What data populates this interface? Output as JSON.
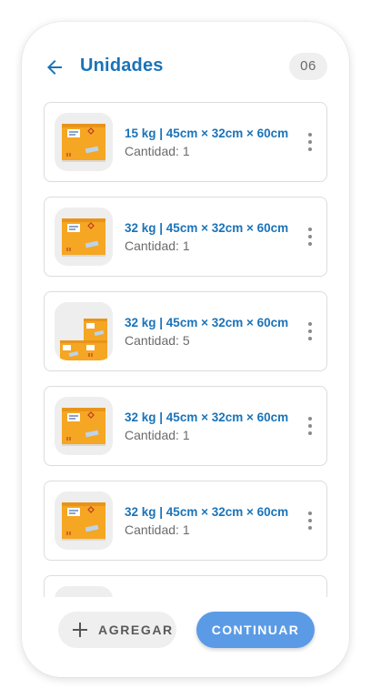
{
  "header": {
    "title": "Unidades",
    "count": "06"
  },
  "units": [
    {
      "dims": "15 kg | 45cm × 32cm × 60cm",
      "qty": "Cantidad: 1",
      "icon": "single-box-icon"
    },
    {
      "dims": "32 kg | 45cm × 32cm × 60cm",
      "qty": "Cantidad: 1",
      "icon": "single-box-icon"
    },
    {
      "dims": "32 kg | 45cm × 32cm × 60cm",
      "qty": "Cantidad: 5",
      "icon": "multiple-boxes-icon"
    },
    {
      "dims": "32 kg | 45cm × 32cm × 60cm",
      "qty": "Cantidad: 1",
      "icon": "single-box-icon"
    },
    {
      "dims": "32 kg | 45cm × 32cm × 60cm",
      "qty": "Cantidad: 1",
      "icon": "single-box-icon"
    },
    {
      "dims": "",
      "qty": "",
      "icon": "single-box-icon"
    }
  ],
  "footer": {
    "add_label": "AGREGAR",
    "continue_label": "CONTINUAR"
  },
  "colors": {
    "accent": "#1a73b8",
    "primary_button": "#5b9be6",
    "box": "#f5a623"
  }
}
